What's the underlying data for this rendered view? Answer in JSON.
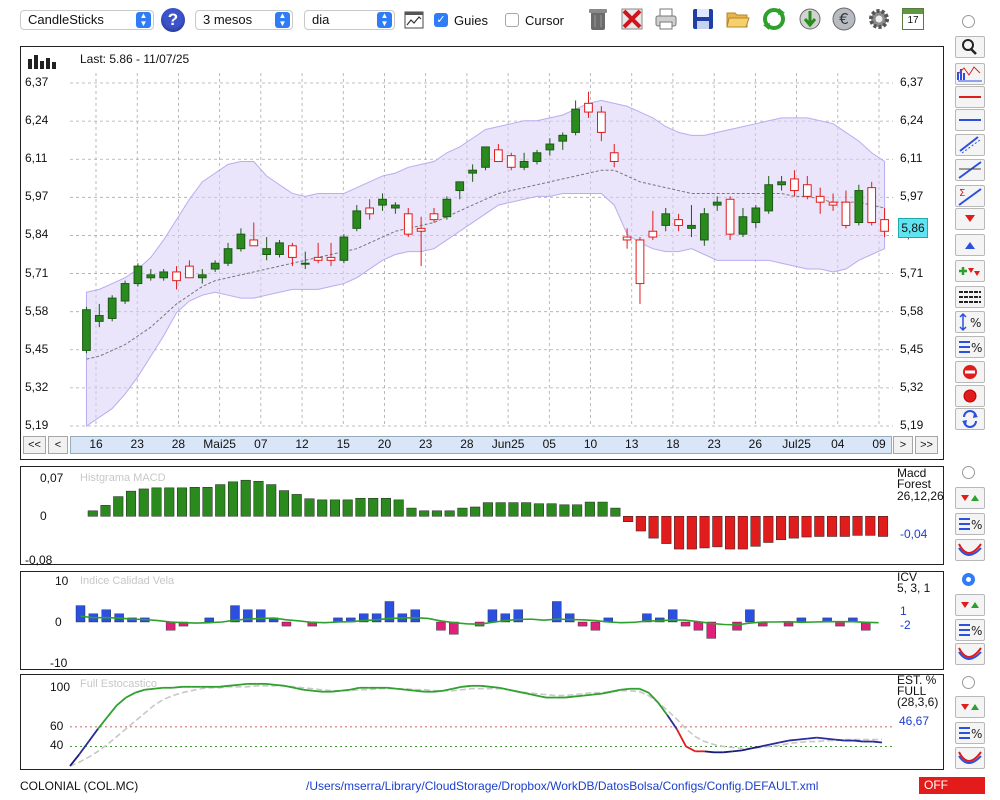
{
  "toolbar": {
    "chart_type": "CandleSticks",
    "help_label": "?",
    "period": "3 mesos",
    "interval": "dia",
    "guides_label": "Guies",
    "guides_checked": true,
    "cursor_label": "Cursor",
    "cursor_checked": false,
    "calendar_day": "17"
  },
  "price_panel": {
    "last_label": "Last: 5.86 - 11/07/25",
    "current_price": "5,86",
    "y_ticks": [
      "6,37",
      "6,24",
      "6,11",
      "5,97",
      "5,84",
      "5,71",
      "5,58",
      "5,45",
      "5,32",
      "5,19"
    ],
    "x_ticks": [
      "16",
      "23",
      "28",
      "Mai25",
      "07",
      "12",
      "15",
      "20",
      "23",
      "28",
      "Jun25",
      "05",
      "10",
      "13",
      "18",
      "23",
      "26",
      "Jul25",
      "04",
      "09"
    ],
    "nav": {
      "first": "<<",
      "prev": "<",
      "next": ">",
      "last": ">>"
    }
  },
  "macd_panel": {
    "title": "Histgrama MACD",
    "y_ticks": [
      "0,07",
      "0",
      "-0,08"
    ],
    "indicator_name": "Macd\nForest",
    "params": "26,12,26",
    "value": "-0,04"
  },
  "icv_panel": {
    "title": "Indice Calidad Vela",
    "y_ticks": [
      "10",
      "0",
      "-10"
    ],
    "indicator_name": "ICV",
    "params": "5, 3, 1",
    "value1": "1",
    "value2": "-2"
  },
  "stoch_panel": {
    "title": "Full Estocastico",
    "y_ticks": [
      "100",
      "60",
      "40"
    ],
    "indicator_name": "EST. %\nFULL",
    "params": "(28,3,6)",
    "value": "46,67"
  },
  "status": {
    "ticker": "COLONIAL (COL.MC)",
    "path": "/Users/mserra/Library/CloudStorage/Dropbox/WorkDB/DatosBolsa/Configs/Config.DEFAULT.xml",
    "state": "OFF"
  },
  "colors": {
    "up": "#2a8a1e",
    "down": "#e01c1c",
    "band": "#d8d0f5",
    "icv_up": "#2b50e0",
    "icv_down": "#e0207a",
    "off": "#e31b1b"
  },
  "chart_data": [
    {
      "type": "candlestick",
      "ylim": [
        5.19,
        6.37
      ],
      "ohlc": [
        [
          5.45,
          5.6,
          5.44,
          5.59
        ],
        [
          5.55,
          5.61,
          5.53,
          5.57
        ],
        [
          5.56,
          5.64,
          5.55,
          5.63
        ],
        [
          5.62,
          5.69,
          5.61,
          5.68
        ],
        [
          5.68,
          5.75,
          5.67,
          5.74
        ],
        [
          5.7,
          5.73,
          5.69,
          5.71
        ],
        [
          5.7,
          5.73,
          5.69,
          5.72
        ],
        [
          5.72,
          5.74,
          5.66,
          5.69
        ],
        [
          5.74,
          5.76,
          5.7,
          5.7
        ],
        [
          5.7,
          5.73,
          5.68,
          5.71
        ],
        [
          5.73,
          5.76,
          5.72,
          5.75
        ],
        [
          5.75,
          5.82,
          5.74,
          5.8
        ],
        [
          5.8,
          5.87,
          5.79,
          5.85
        ],
        [
          5.83,
          5.89,
          5.82,
          5.81
        ],
        [
          5.78,
          5.84,
          5.76,
          5.8
        ],
        [
          5.78,
          5.83,
          5.77,
          5.82
        ],
        [
          5.81,
          5.82,
          5.74,
          5.77
        ],
        [
          5.75,
          5.79,
          5.73,
          5.75
        ],
        [
          5.77,
          5.82,
          5.75,
          5.76
        ],
        [
          5.77,
          5.82,
          5.74,
          5.76
        ],
        [
          5.76,
          5.85,
          5.75,
          5.84
        ],
        [
          5.87,
          5.95,
          5.86,
          5.93
        ],
        [
          5.94,
          5.97,
          5.9,
          5.92
        ],
        [
          5.95,
          5.99,
          5.93,
          5.97
        ],
        [
          5.94,
          5.96,
          5.92,
          5.95
        ],
        [
          5.92,
          5.94,
          5.84,
          5.85
        ],
        [
          5.87,
          5.91,
          5.74,
          5.86
        ],
        [
          5.92,
          5.94,
          5.89,
          5.9
        ],
        [
          5.91,
          5.98,
          5.9,
          5.97
        ],
        [
          6.0,
          6.03,
          5.97,
          6.03
        ],
        [
          6.06,
          6.09,
          6.03,
          6.07
        ],
        [
          6.08,
          6.14,
          6.07,
          6.15
        ],
        [
          6.14,
          6.16,
          6.1,
          6.1
        ],
        [
          6.12,
          6.13,
          6.07,
          6.08
        ],
        [
          6.08,
          6.13,
          6.07,
          6.1
        ],
        [
          6.1,
          6.14,
          6.09,
          6.13
        ],
        [
          6.14,
          6.18,
          6.12,
          6.16
        ],
        [
          6.17,
          6.2,
          6.14,
          6.19
        ],
        [
          6.2,
          6.31,
          6.19,
          6.28
        ],
        [
          6.3,
          6.34,
          6.25,
          6.27
        ],
        [
          6.27,
          6.29,
          6.17,
          6.2
        ],
        [
          6.13,
          6.16,
          6.08,
          6.1
        ],
        [
          5.84,
          5.87,
          5.8,
          5.83
        ],
        [
          5.83,
          5.84,
          5.61,
          5.68
        ],
        [
          5.86,
          5.93,
          5.83,
          5.84
        ],
        [
          5.88,
          5.94,
          5.86,
          5.92
        ],
        [
          5.9,
          5.92,
          5.86,
          5.88
        ],
        [
          5.87,
          5.95,
          5.84,
          5.88
        ],
        [
          5.83,
          5.94,
          5.81,
          5.92
        ],
        [
          5.95,
          5.98,
          5.93,
          5.96
        ],
        [
          5.97,
          5.98,
          5.83,
          5.85
        ],
        [
          5.85,
          5.94,
          5.84,
          5.91
        ],
        [
          5.89,
          5.95,
          5.87,
          5.94
        ],
        [
          5.93,
          6.05,
          5.92,
          6.02
        ],
        [
          6.02,
          6.05,
          6.0,
          6.03
        ],
        [
          6.04,
          6.07,
          5.98,
          6.0
        ],
        [
          6.02,
          6.05,
          5.97,
          5.98
        ],
        [
          5.98,
          6.01,
          5.92,
          5.96
        ],
        [
          5.96,
          5.99,
          5.93,
          5.95
        ],
        [
          5.96,
          6.0,
          5.87,
          5.88
        ],
        [
          5.89,
          6.02,
          5.88,
          6.0
        ],
        [
          6.01,
          6.03,
          5.88,
          5.89
        ],
        [
          5.9,
          5.94,
          5.84,
          5.86
        ]
      ],
      "band_upper": [
        5.65,
        5.66,
        5.68,
        5.7,
        5.73,
        5.77,
        5.83,
        5.9,
        5.97,
        6.03,
        6.06,
        6.09,
        6.1,
        6.1,
        6.05,
        6.02,
        5.99,
        5.98,
        5.99,
        5.99,
        5.99,
        6.01,
        6.03,
        6.05,
        6.06,
        6.08,
        6.09,
        6.1,
        6.13,
        6.15,
        6.18,
        6.21,
        6.22,
        6.23,
        6.24,
        6.24,
        6.25,
        6.26,
        6.28,
        6.3,
        6.31,
        6.3,
        6.29,
        6.27,
        6.25,
        6.22,
        6.2,
        6.19,
        6.19,
        6.2,
        6.21,
        6.22,
        6.23,
        6.24,
        6.25,
        6.25,
        6.25,
        6.24,
        6.23,
        6.2,
        6.17,
        6.13,
        6.1
      ],
      "band_lower": [
        5.19,
        5.22,
        5.25,
        5.3,
        5.36,
        5.43,
        5.5,
        5.58,
        5.62,
        5.64,
        5.65,
        5.64,
        5.63,
        5.63,
        5.64,
        5.65,
        5.66,
        5.66,
        5.66,
        5.67,
        5.68,
        5.7,
        5.73,
        5.76,
        5.78,
        5.79,
        5.79,
        5.8,
        5.83,
        5.86,
        5.89,
        5.92,
        5.95,
        5.96,
        5.97,
        5.98,
        5.98,
        5.99,
        5.99,
        5.99,
        5.99,
        5.95,
        5.85,
        5.82,
        5.8,
        5.79,
        5.79,
        5.8,
        5.78,
        5.76,
        5.76,
        5.76,
        5.76,
        5.76,
        5.75,
        5.74,
        5.73,
        5.73,
        5.72,
        5.73,
        5.76,
        5.78,
        5.8
      ],
      "band_mid": [
        5.42,
        5.43,
        5.45,
        5.47,
        5.5,
        5.53,
        5.57,
        5.61,
        5.64,
        5.67,
        5.69,
        5.7,
        5.71,
        5.72,
        5.73,
        5.74,
        5.75,
        5.76,
        5.77,
        5.78,
        5.79,
        5.8,
        5.82,
        5.84,
        5.86,
        5.87,
        5.88,
        5.89,
        5.91,
        5.93,
        5.95,
        5.97,
        5.99,
        6.0,
        6.01,
        6.02,
        6.03,
        6.04,
        6.05,
        6.06,
        6.07,
        6.07,
        6.05,
        6.03,
        6.02,
        6.01,
        6.0,
        5.99,
        5.99,
        5.99,
        5.99,
        5.99,
        5.99,
        5.99,
        5.99,
        5.98,
        5.98,
        5.97,
        5.96,
        5.96,
        5.96,
        5.95,
        5.94
      ]
    },
    {
      "type": "bar",
      "ylim": [
        -0.08,
        0.07
      ],
      "values": [
        0.01,
        0.02,
        0.036,
        0.046,
        0.05,
        0.052,
        0.052,
        0.052,
        0.053,
        0.053,
        0.058,
        0.063,
        0.066,
        0.064,
        0.058,
        0.047,
        0.04,
        0.032,
        0.03,
        0.03,
        0.03,
        0.033,
        0.033,
        0.033,
        0.03,
        0.015,
        0.01,
        0.01,
        0.01,
        0.015,
        0.017,
        0.025,
        0.025,
        0.025,
        0.025,
        0.023,
        0.023,
        0.021,
        0.021,
        0.026,
        0.026,
        0.015,
        -0.01,
        -0.027,
        -0.04,
        -0.05,
        -0.06,
        -0.06,
        -0.058,
        -0.056,
        -0.06,
        -0.06,
        -0.055,
        -0.048,
        -0.043,
        -0.04,
        -0.038,
        -0.037,
        -0.037,
        -0.037,
        -0.035,
        -0.035,
        -0.037
      ]
    },
    {
      "type": "bar",
      "ylim": [
        -10,
        10
      ],
      "values": [
        4,
        2,
        3,
        2,
        1,
        1,
        0,
        -2,
        -1,
        0,
        1,
        0,
        4,
        3,
        3,
        1,
        -1,
        0,
        -1,
        0,
        1,
        1,
        2,
        2,
        5,
        2,
        3,
        0,
        -2,
        -3,
        0,
        -1,
        3,
        2,
        3,
        0,
        0,
        5,
        2,
        -1,
        -2,
        1,
        0,
        0,
        2,
        1,
        3,
        -1,
        -2,
        -4,
        0,
        -2,
        3,
        -1,
        0,
        -1,
        1,
        0,
        1,
        -1,
        1,
        -2,
        0
      ]
    },
    {
      "type": "line",
      "ylim": [
        20,
        110
      ],
      "series": [
        {
          "values": [
            20,
            32,
            45,
            58,
            70,
            82,
            90,
            95,
            98,
            99,
            100,
            100,
            101,
            101,
            101,
            101,
            101,
            102,
            103,
            104,
            104,
            104,
            103,
            102,
            100,
            98,
            97,
            96,
            96,
            97,
            98,
            100,
            100,
            100,
            100,
            99,
            98,
            97,
            96,
            96,
            97,
            99,
            101,
            102,
            102,
            101,
            100,
            98,
            96,
            94,
            92,
            90,
            90,
            90,
            91,
            92,
            93,
            94,
            96,
            98,
            99,
            99,
            95,
            85,
            72,
            58,
            40,
            35,
            35,
            34,
            34,
            35,
            36,
            38,
            40,
            42,
            44,
            46,
            47,
            48,
            49,
            48,
            47,
            46,
            46,
            45,
            45,
            44
          ]
        },
        {
          "values": [
            20,
            24,
            29,
            35,
            42,
            50,
            58,
            66,
            74,
            82,
            88,
            92,
            95,
            97,
            99,
            100,
            100,
            101,
            101,
            101,
            102,
            102,
            102,
            102,
            101,
            100,
            99,
            98,
            97,
            97,
            97,
            98,
            98,
            99,
            99,
            99,
            99,
            98,
            98,
            97,
            97,
            97,
            98,
            99,
            99,
            99,
            99,
            98,
            96,
            95,
            94,
            93,
            92,
            92,
            93,
            94,
            95,
            95,
            96,
            97,
            97,
            96,
            92,
            85,
            77,
            68,
            58,
            50,
            45,
            42,
            40,
            39,
            38,
            38,
            39,
            40,
            41,
            43,
            44,
            45,
            45,
            46,
            46,
            47,
            47,
            47,
            47,
            47
          ]
        }
      ]
    }
  ]
}
